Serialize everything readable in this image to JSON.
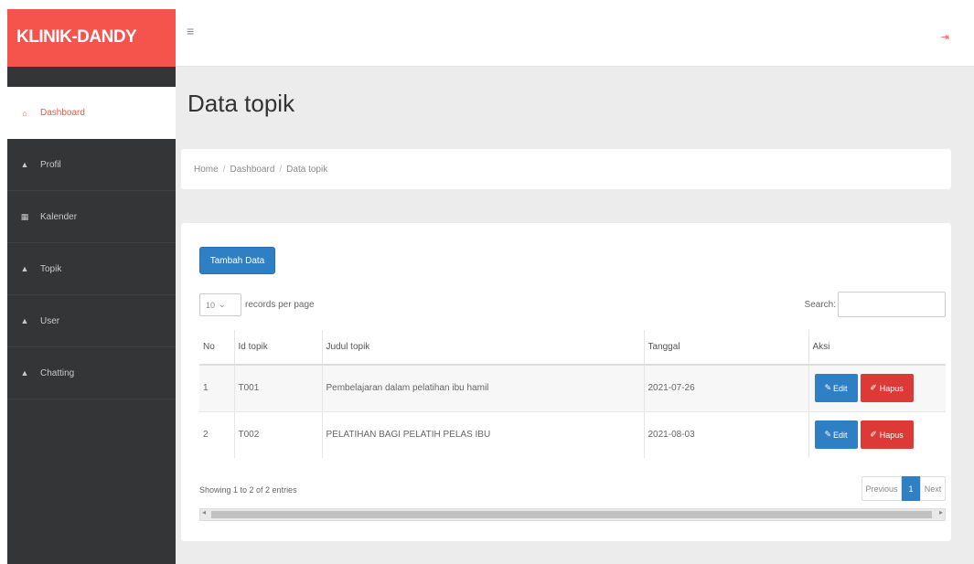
{
  "brand": "KLINIK-DANDY",
  "topbar": {
    "menu_icon": "≡",
    "signout_icon": "⇥"
  },
  "sidebar": {
    "items": [
      {
        "label": "Dashboard",
        "icon": "⌂"
      },
      {
        "label": "Profil",
        "icon": "▲"
      },
      {
        "label": "Kalender",
        "icon": "▦"
      },
      {
        "label": "Topik",
        "icon": "▲"
      },
      {
        "label": "User",
        "icon": "▲"
      },
      {
        "label": "Chatting",
        "icon": "▲"
      }
    ]
  },
  "page_title": "Data topik",
  "breadcrumb": {
    "home": "Home",
    "dashboard": "Dashboard",
    "current": "Data topik",
    "separator": "/"
  },
  "card": {
    "add_button": "Tambah Data",
    "length_value": "10",
    "length_suffix": "records per page",
    "search_label": "Search:",
    "columns": [
      "No",
      "Id topik",
      "Judul topik",
      "Tanggal",
      "Aksi"
    ],
    "rows": [
      {
        "no": "1",
        "id": "T001",
        "judul": "Pembelajaran dalam pelatihan ibu hamil",
        "tanggal": "2021-07-26"
      },
      {
        "no": "2",
        "id": "T002",
        "judul": "PELATIHAN BAGI PELATIH PELAS IBU",
        "tanggal": "2021-08-03"
      }
    ],
    "edit_label": "Edit",
    "delete_label": "Hapus",
    "info": "Showing 1 to 2 of 2 entries",
    "pager": {
      "prev": "Previous",
      "current": "1",
      "next": "Next"
    }
  },
  "colors": {
    "brand": "#f5544d",
    "primary": "#2e7fc4",
    "danger": "#dd3a37",
    "sidebar": "#333536"
  }
}
